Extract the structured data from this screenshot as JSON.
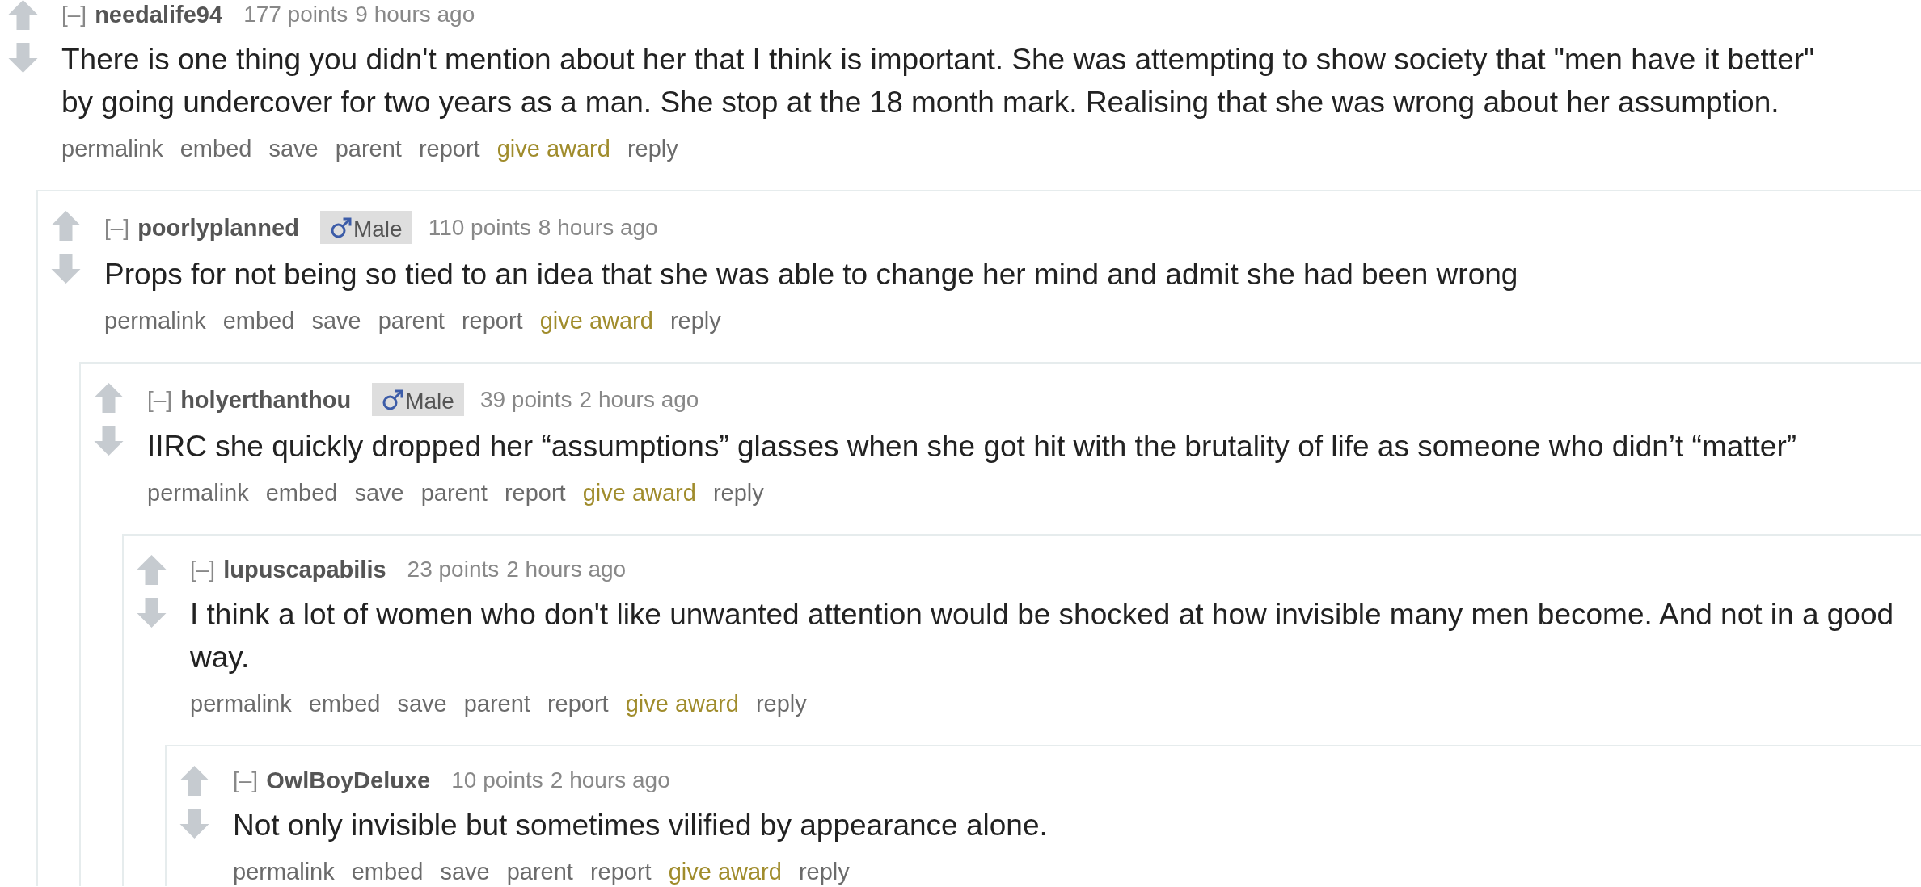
{
  "comments": [
    {
      "collapse_toggle": "[–]",
      "author": "needalife94",
      "score": "177 points",
      "time": "9 hours ago",
      "body": "There is one thing you didn't mention about her that I think is important. She was attempting to show society that \"men have it better\" by going undercover for two years as a man. She stop at the 18 month mark. Realising that she was wrong about her assumption.",
      "actions": [
        {
          "label": "permalink",
          "kind": "link"
        },
        {
          "label": "embed",
          "kind": "link"
        },
        {
          "label": "save",
          "kind": "link"
        },
        {
          "label": "parent",
          "kind": "link"
        },
        {
          "label": "report",
          "kind": "link"
        },
        {
          "label": "give award",
          "kind": "award"
        },
        {
          "label": "reply",
          "kind": "link"
        }
      ],
      "children": [
        {
          "collapse_toggle": "[–]",
          "author": "poorlyplanned",
          "flair": {
            "text": "Male"
          },
          "score": "110 points",
          "time": "8 hours ago",
          "body": "Props for not being so tied to an idea that she was able to change her mind and admit she had been wrong",
          "actions": [
            {
              "label": "permalink",
              "kind": "link"
            },
            {
              "label": "embed",
              "kind": "link"
            },
            {
              "label": "save",
              "kind": "link"
            },
            {
              "label": "parent",
              "kind": "link"
            },
            {
              "label": "report",
              "kind": "link"
            },
            {
              "label": "give award",
              "kind": "award"
            },
            {
              "label": "reply",
              "kind": "link"
            }
          ],
          "children": [
            {
              "collapse_toggle": "[–]",
              "author": "holyerthanthou",
              "flair": {
                "text": "Male"
              },
              "score": "39 points",
              "time": "2 hours ago",
              "body": "IIRC she quickly dropped her “assumptions” glasses when she got hit with the brutality of life as someone who didn’t “matter”",
              "actions": [
                {
                  "label": "permalink",
                  "kind": "link"
                },
                {
                  "label": "embed",
                  "kind": "link"
                },
                {
                  "label": "save",
                  "kind": "link"
                },
                {
                  "label": "parent",
                  "kind": "link"
                },
                {
                  "label": "report",
                  "kind": "link"
                },
                {
                  "label": "give award",
                  "kind": "award"
                },
                {
                  "label": "reply",
                  "kind": "link"
                }
              ],
              "children": [
                {
                  "collapse_toggle": "[–]",
                  "author": "lupuscapabilis",
                  "score": "23 points",
                  "time": "2 hours ago",
                  "body": "I think a lot of women who don't like unwanted attention would be shocked at how invisible many men become. And not in a good way.",
                  "actions": [
                    {
                      "label": "permalink",
                      "kind": "link"
                    },
                    {
                      "label": "embed",
                      "kind": "link"
                    },
                    {
                      "label": "save",
                      "kind": "link"
                    },
                    {
                      "label": "parent",
                      "kind": "link"
                    },
                    {
                      "label": "report",
                      "kind": "link"
                    },
                    {
                      "label": "give award",
                      "kind": "award"
                    },
                    {
                      "label": "reply",
                      "kind": "link"
                    }
                  ],
                  "children": [
                    {
                      "collapse_toggle": "[–]",
                      "author": "OwlBoyDeluxe",
                      "score": "10 points",
                      "time": "2 hours ago",
                      "body": "Not only invisible but sometimes vilified by appearance alone.",
                      "actions": [
                        {
                          "label": "permalink",
                          "kind": "link"
                        },
                        {
                          "label": "embed",
                          "kind": "link"
                        },
                        {
                          "label": "save",
                          "kind": "link"
                        },
                        {
                          "label": "parent",
                          "kind": "link"
                        },
                        {
                          "label": "report",
                          "kind": "link"
                        },
                        {
                          "label": "give award",
                          "kind": "award"
                        },
                        {
                          "label": "reply",
                          "kind": "link"
                        }
                      ]
                    }
                  ]
                }
              ]
            }
          ]
        }
      ]
    }
  ]
}
